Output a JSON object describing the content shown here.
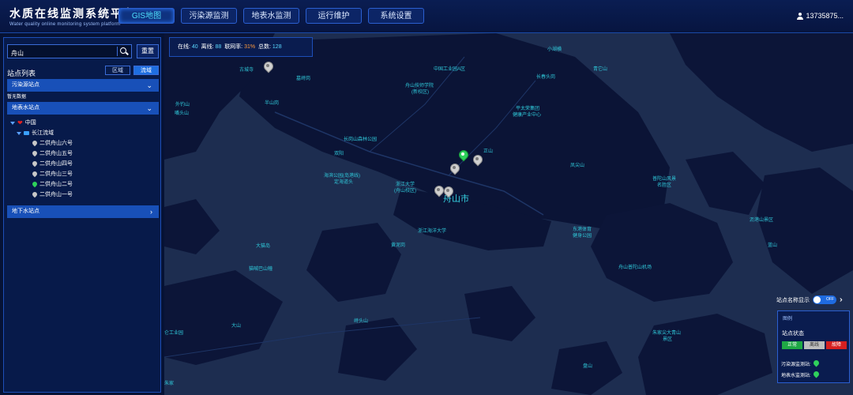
{
  "header": {
    "title": "水质在线监测系统平台",
    "subtitle": "Water quality online monitoring system platform",
    "nav": [
      {
        "label": "GIS地图",
        "active": true
      },
      {
        "label": "污染源监测"
      },
      {
        "label": "地表水监测"
      },
      {
        "label": "运行维护"
      },
      {
        "label": "系统设置"
      }
    ],
    "user": "13735875..."
  },
  "sidebar": {
    "search_value": "舟山",
    "reset_label": "重置",
    "list_title": "站点列表",
    "toggle": [
      "区域",
      "流域"
    ],
    "sections": {
      "pollution": "污染源站点",
      "no_data": "暂无数据",
      "surface": "地表水站点",
      "ground": "地下水站点"
    },
    "tree": {
      "root": "中国",
      "basin": "长江流域",
      "stations": [
        {
          "name": "二供舟山六号",
          "status": "offline"
        },
        {
          "name": "二供舟山五号",
          "status": "offline"
        },
        {
          "name": "二供舟山四号",
          "status": "offline"
        },
        {
          "name": "二供舟山三号",
          "status": "offline"
        },
        {
          "name": "二供舟山二号",
          "status": "normal"
        },
        {
          "name": "二供舟山一号",
          "status": "offline"
        }
      ]
    }
  },
  "stats": {
    "online_label": "在线:",
    "online": "40",
    "offline_label": "离线:",
    "offline": "88",
    "rate_label": "联网率:",
    "rate": "31%",
    "total_label": "总数:",
    "total": "128"
  },
  "map_labels": [
    "古城寺",
    "墓峙岗",
    "中国工业园A区",
    "小湖横",
    "舟山技师学院",
    "(新校区)",
    "长春头岗",
    "青它山",
    "外钓山",
    "嘴头山",
    "半山岗",
    "平太荣集团",
    "健康产业中心",
    "长岗山森林公园",
    "正山",
    "双阳",
    "海滨公园(岛港线)",
    "定海道头",
    "浙江大学",
    "(舟山校区)",
    "舟山市",
    "凤尖山",
    "普陀山风景",
    "名胜区",
    "沥港山景区",
    "浙江海洋大学",
    "东港体育",
    "健身公园",
    "黄泥岗",
    "大猫岛",
    "蓝山",
    "猫喊巴山幢",
    "舟山普陀山机场",
    "大山",
    "峙头山",
    "仑工业园",
    "朱家尖大青山",
    "景区",
    "盘山",
    "朱家"
  ],
  "legend": {
    "name_toggle_label": "站点名称显示",
    "switch_label": "OFF",
    "title": "图例",
    "status_title": "站点状态",
    "badges": [
      "正常",
      "离线",
      "故障"
    ],
    "pollution_station": "污染源监测站:",
    "surface_station": "地表水监测站:"
  },
  "colors": {
    "accent": "#1e6ee0",
    "normal": "#1fa845",
    "offline": "#bdbdbd",
    "fault": "#d62020"
  }
}
